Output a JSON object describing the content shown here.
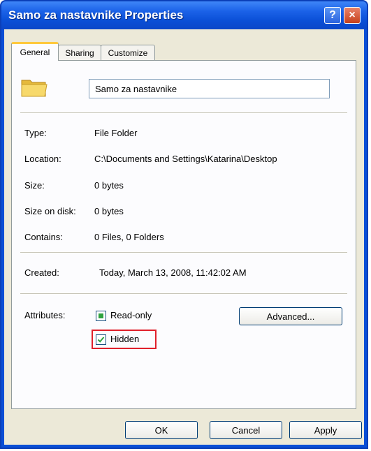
{
  "window": {
    "title": "Samo za nastavnike Properties",
    "help_glyph": "?",
    "close_glyph": "×"
  },
  "tabs": [
    {
      "label": "General",
      "active": true
    },
    {
      "label": "Sharing",
      "active": false
    },
    {
      "label": "Customize",
      "active": false
    }
  ],
  "general": {
    "folder_name": "Samo za nastavnike",
    "fields": {
      "type": {
        "label": "Type:",
        "value": "File Folder"
      },
      "location": {
        "label": "Location:",
        "value": "C:\\Documents and Settings\\Katarina\\Desktop"
      },
      "size": {
        "label": "Size:",
        "value": "0 bytes"
      },
      "size_on_disk": {
        "label": "Size on disk:",
        "value": "0 bytes"
      },
      "contains": {
        "label": "Contains:",
        "value": "0 Files, 0 Folders"
      },
      "created": {
        "label": "Created:",
        "value": "Today, March 13, 2008, 11:42:02 AM"
      }
    },
    "attributes": {
      "label": "Attributes:",
      "read_only": {
        "label": "Read-only",
        "state": "indeterminate"
      },
      "hidden": {
        "label": "Hidden",
        "state": "checked"
      },
      "advanced_label": "Advanced..."
    }
  },
  "buttons": {
    "ok": "OK",
    "cancel": "Cancel",
    "apply": "Apply"
  },
  "colors": {
    "titlebar": "#0a4fd6",
    "dialog_face": "#ece9d8",
    "highlight": "#e0202b",
    "checkmark": "#2ea23f"
  },
  "icons": {
    "folder": "folder-icon",
    "help": "help-icon",
    "close": "close-icon"
  }
}
